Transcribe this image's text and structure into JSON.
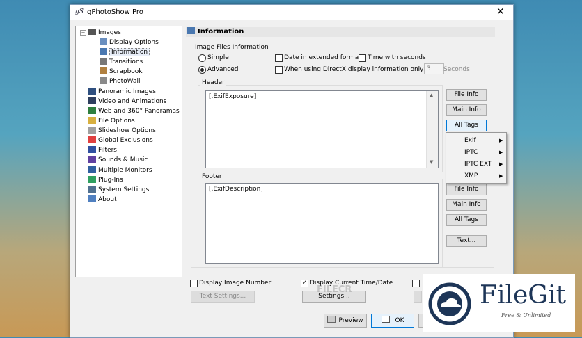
{
  "window": {
    "title": "gPhotoShow Pro",
    "app_icon": "gS",
    "close_glyph": "✕"
  },
  "tree": {
    "items": [
      {
        "label": "Images",
        "icon": "images-icon",
        "color": "#555555"
      },
      {
        "label": "Display Options",
        "icon": "display-options-icon",
        "color": "#6a8fbf"
      },
      {
        "label": "Information",
        "icon": "information-icon",
        "color": "#4a78b0"
      },
      {
        "label": "Transitions",
        "icon": "transitions-icon",
        "color": "#777777"
      },
      {
        "label": "Scrapbook",
        "icon": "scrapbook-icon",
        "color": "#b08040"
      },
      {
        "label": "PhotoWall",
        "icon": "photowall-icon",
        "color": "#8a8a8a"
      },
      {
        "label": "Panoramic Images",
        "icon": "panoramic-icon",
        "color": "#2f4f7f"
      },
      {
        "label": "Video and Animations",
        "icon": "video-icon",
        "color": "#2f3f5f"
      },
      {
        "label": "Web and 360° Panoramas",
        "icon": "globe-icon",
        "color": "#2f7f3f"
      },
      {
        "label": "File Options",
        "icon": "file-options-icon",
        "color": "#d8b040"
      },
      {
        "label": "Slideshow Options",
        "icon": "slideshow-options-icon",
        "color": "#a0a0a0"
      },
      {
        "label": "Global Exclusions",
        "icon": "exclusions-icon",
        "color": "#e04040"
      },
      {
        "label": "Filters",
        "icon": "filters-icon",
        "color": "#3050a0"
      },
      {
        "label": "Sounds & Music",
        "icon": "music-icon",
        "color": "#6040a0"
      },
      {
        "label": "Multiple Monitors",
        "icon": "monitors-icon",
        "color": "#3060a0"
      },
      {
        "label": "Plug-Ins",
        "icon": "plugins-icon",
        "color": "#30a060"
      },
      {
        "label": "System Settings",
        "icon": "system-settings-icon",
        "color": "#507090"
      },
      {
        "label": "About",
        "icon": "about-icon",
        "color": "#5080c0"
      }
    ],
    "expand_glyph": "−"
  },
  "panel": {
    "title": "Information"
  },
  "info": {
    "group_label": "Image Files Information",
    "simple_label": "Simple",
    "advanced_label": "Advanced",
    "date_extended_label": "Date in extended format",
    "time_seconds_label": "Time with seconds",
    "directx_label": "When using DirectX display information only for :",
    "seconds_value": "3",
    "seconds_unit": "Seconds",
    "header_label": "Header",
    "header_text": "[.ExifExposure]",
    "footer_label": "Footer",
    "footer_text": "[.ExifDescription]"
  },
  "buttons": {
    "file_info": "File Info",
    "main_info": "Main Info",
    "all_tags": "All Tags",
    "text": "Text..."
  },
  "menu": {
    "items": [
      "Exif",
      "IPTC",
      "IPTC EXT",
      "XMP"
    ],
    "arrow": "▶"
  },
  "bottom": {
    "display_image_number": "Display Image Number",
    "display_current_time": "Display Current Time/Date",
    "text_settings": "Text Settings...",
    "settings": "Settings...",
    "preview": "Preview",
    "ok": "OK"
  },
  "watermark": {
    "text": "FILECR"
  },
  "logo": {
    "name": "FileGit",
    "tagline": "Free & Unlimited",
    "brand_color": "#1d3557"
  }
}
